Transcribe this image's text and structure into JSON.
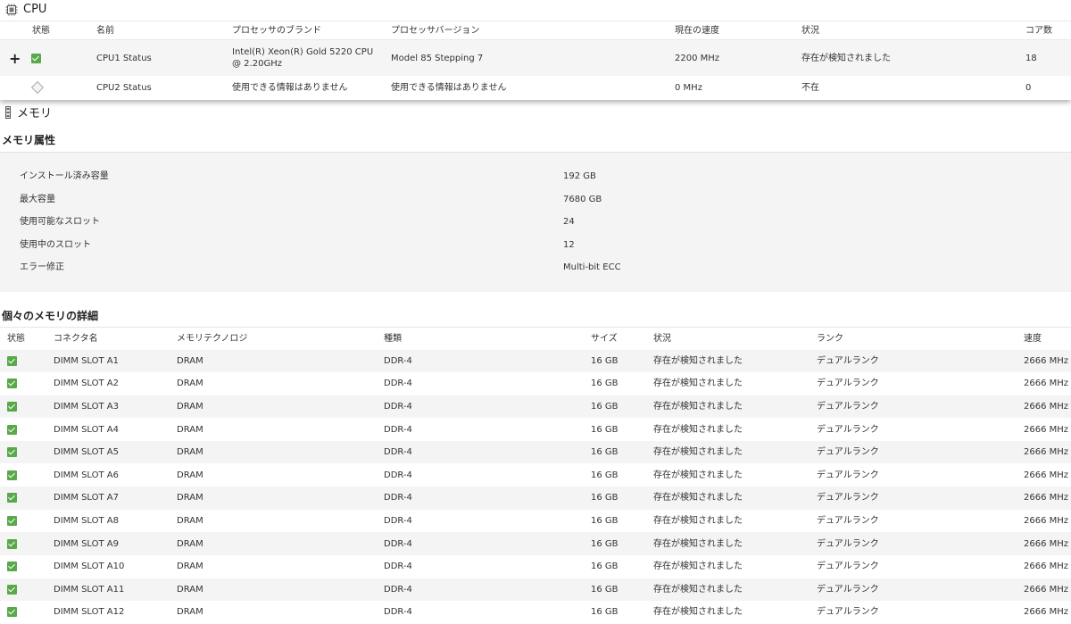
{
  "cpu": {
    "title": "CPU",
    "headers": [
      "状態",
      "名前",
      "プロセッサのブランド",
      "プロセッサバージョン",
      "現在の速度",
      "状況",
      "コア数"
    ],
    "rows": [
      {
        "expand": "+",
        "name": "CPU1 Status",
        "brand": "Intel(R) Xeon(R) Gold 5220 CPU @ 2.20GHz",
        "version": "Model 85 Stepping 7",
        "speed": "2200 MHz",
        "status": "存在が検知されました",
        "cores": "18"
      },
      {
        "expand": "",
        "name": "CPU2 Status",
        "brand": "使用できる情報はありません",
        "version": "使用できる情報はありません",
        "speed": "0 MHz",
        "status": "不在",
        "cores": "0"
      }
    ]
  },
  "memory": {
    "title": "メモリ",
    "attributes_title": "メモリ属性",
    "attributes": [
      {
        "label": "インストール済み容量",
        "value": "192 GB"
      },
      {
        "label": "最大容量",
        "value": "7680 GB"
      },
      {
        "label": "使用可能なスロット",
        "value": "24"
      },
      {
        "label": "使用中のスロット",
        "value": "12"
      },
      {
        "label": "エラー修正",
        "value": "Multi-bit ECC"
      }
    ],
    "details_title": "個々のメモリの詳細",
    "details_headers": [
      "状態",
      "コネクタ名",
      "メモリテクノロジ",
      "種類",
      "サイズ",
      "状況",
      "ランク",
      "速度"
    ],
    "dimms": [
      {
        "connector": "DIMM SLOT A1",
        "tech": "DRAM",
        "type": "DDR-4",
        "size": "16 GB",
        "status": "存在が検知されました",
        "rank": "デュアルランク",
        "speed": "2666 MHz"
      },
      {
        "connector": "DIMM SLOT A2",
        "tech": "DRAM",
        "type": "DDR-4",
        "size": "16 GB",
        "status": "存在が検知されました",
        "rank": "デュアルランク",
        "speed": "2666 MHz"
      },
      {
        "connector": "DIMM SLOT A3",
        "tech": "DRAM",
        "type": "DDR-4",
        "size": "16 GB",
        "status": "存在が検知されました",
        "rank": "デュアルランク",
        "speed": "2666 MHz"
      },
      {
        "connector": "DIMM SLOT A4",
        "tech": "DRAM",
        "type": "DDR-4",
        "size": "16 GB",
        "status": "存在が検知されました",
        "rank": "デュアルランク",
        "speed": "2666 MHz"
      },
      {
        "connector": "DIMM SLOT A5",
        "tech": "DRAM",
        "type": "DDR-4",
        "size": "16 GB",
        "status": "存在が検知されました",
        "rank": "デュアルランク",
        "speed": "2666 MHz"
      },
      {
        "connector": "DIMM SLOT A6",
        "tech": "DRAM",
        "type": "DDR-4",
        "size": "16 GB",
        "status": "存在が検知されました",
        "rank": "デュアルランク",
        "speed": "2666 MHz"
      },
      {
        "connector": "DIMM SLOT A7",
        "tech": "DRAM",
        "type": "DDR-4",
        "size": "16 GB",
        "status": "存在が検知されました",
        "rank": "デュアルランク",
        "speed": "2666 MHz"
      },
      {
        "connector": "DIMM SLOT A8",
        "tech": "DRAM",
        "type": "DDR-4",
        "size": "16 GB",
        "status": "存在が検知されました",
        "rank": "デュアルランク",
        "speed": "2666 MHz"
      },
      {
        "connector": "DIMM SLOT A9",
        "tech": "DRAM",
        "type": "DDR-4",
        "size": "16 GB",
        "status": "存在が検知されました",
        "rank": "デュアルランク",
        "speed": "2666 MHz"
      },
      {
        "connector": "DIMM SLOT A10",
        "tech": "DRAM",
        "type": "DDR-4",
        "size": "16 GB",
        "status": "存在が検知されました",
        "rank": "デュアルランク",
        "speed": "2666 MHz"
      },
      {
        "connector": "DIMM SLOT A11",
        "tech": "DRAM",
        "type": "DDR-4",
        "size": "16 GB",
        "status": "存在が検知されました",
        "rank": "デュアルランク",
        "speed": "2666 MHz"
      },
      {
        "connector": "DIMM SLOT A12",
        "tech": "DRAM",
        "type": "DDR-4",
        "size": "16 GB",
        "status": "存在が検知されました",
        "rank": "デュアルランク",
        "speed": "2666 MHz"
      }
    ]
  },
  "colors": {
    "ok_check": "#59a84a",
    "row_alt": "#f4f4f4"
  },
  "icons": {
    "cpu": "cpu-chip-icon",
    "memory": "memory-module-icon",
    "ok": "check-ok-icon",
    "absent": "diamond-absent-icon",
    "expand": "plus-expand-icon"
  }
}
